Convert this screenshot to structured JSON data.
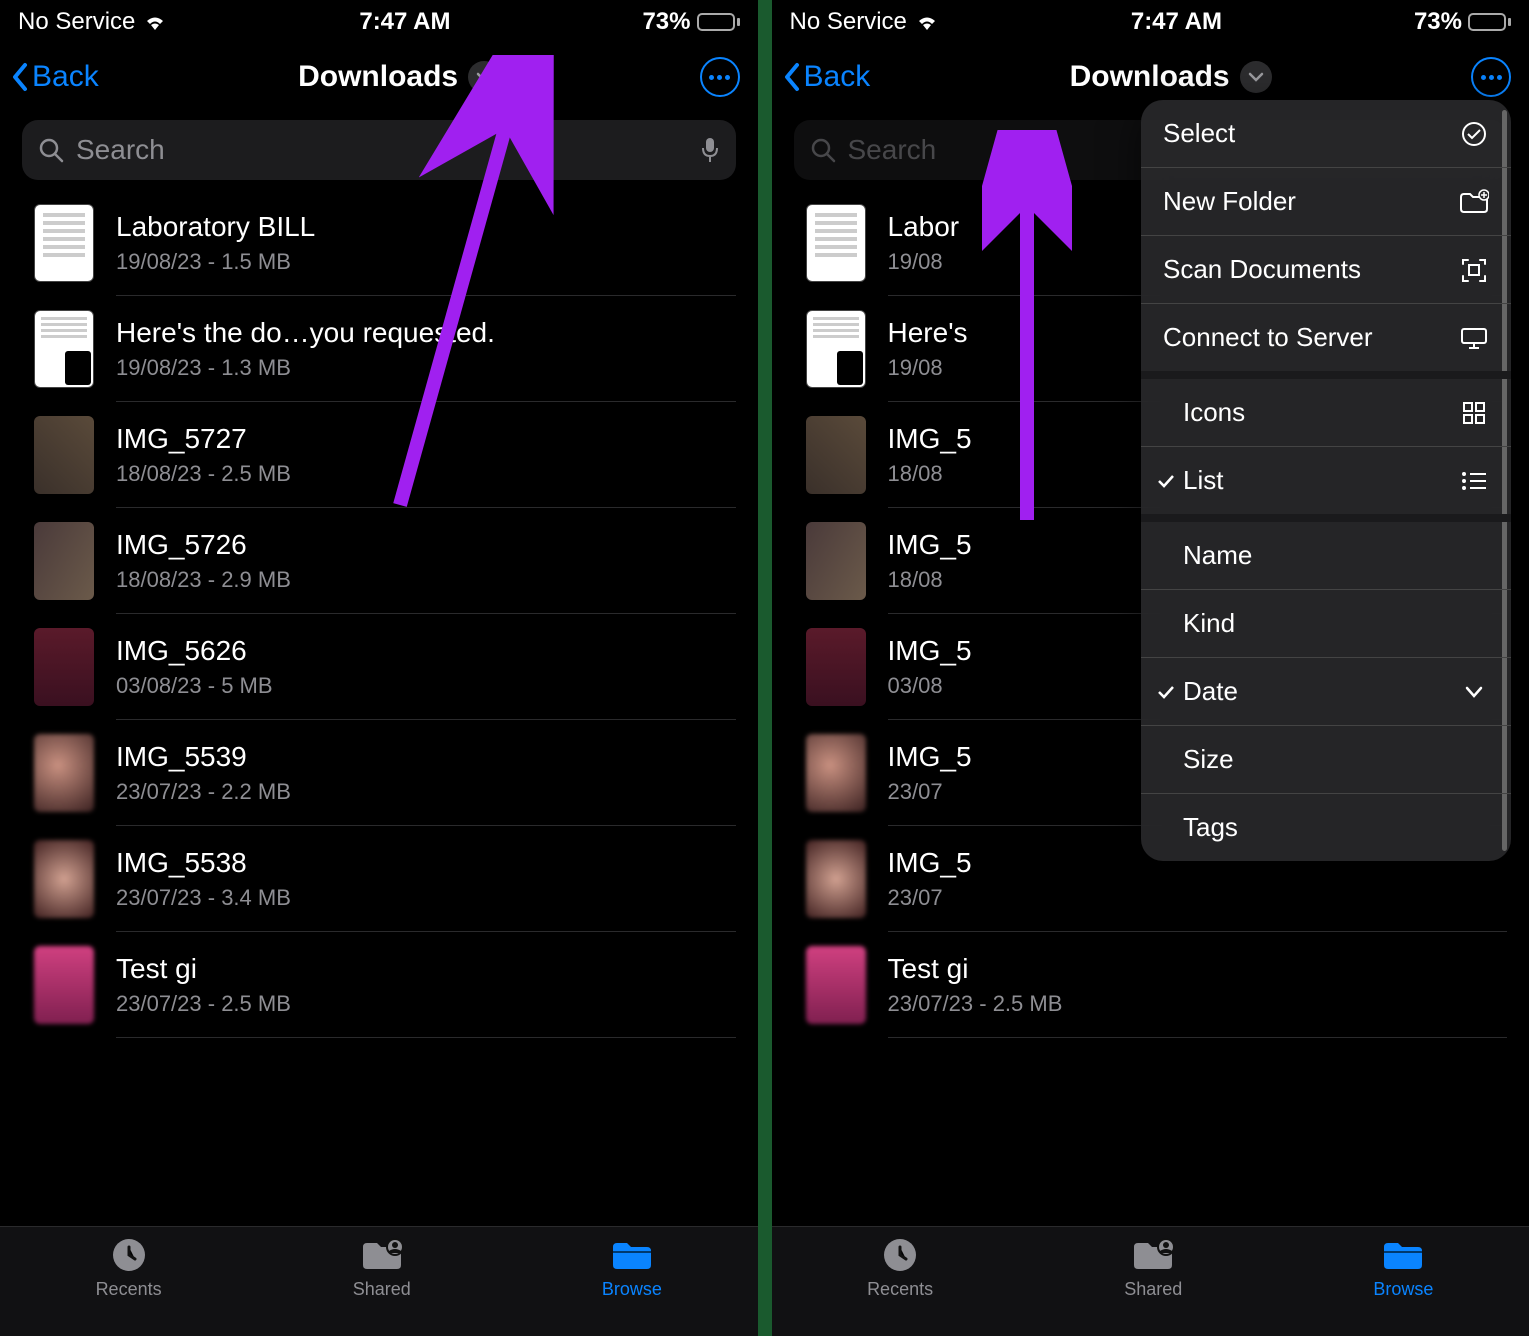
{
  "status": {
    "service": "No Service",
    "time": "7:47 AM",
    "battery_pct": "73%"
  },
  "nav": {
    "back": "Back",
    "title": "Downloads"
  },
  "search": {
    "placeholder": "Search"
  },
  "files": [
    {
      "title": "Laboratory BILL",
      "sub": "19/08/23 - 1.5 MB",
      "thumb": "doc"
    },
    {
      "title": "Here's the do…you requested.",
      "sub": "19/08/23 - 1.3 MB",
      "thumb": "doc2"
    },
    {
      "title": "IMG_5727",
      "sub": "18/08/23 - 2.5 MB",
      "thumb": "photo1"
    },
    {
      "title": "IMG_5726",
      "sub": "18/08/23 - 2.9 MB",
      "thumb": "photo2"
    },
    {
      "title": "IMG_5626",
      "sub": "03/08/23 - 5 MB",
      "thumb": "photo3"
    },
    {
      "title": "IMG_5539",
      "sub": "23/07/23 - 2.2 MB",
      "thumb": "blur1"
    },
    {
      "title": "IMG_5538",
      "sub": "23/07/23 - 3.4 MB",
      "thumb": "blur2"
    },
    {
      "title": "Test gi",
      "sub": "23/07/23 - 2.5 MB",
      "thumb": "blur3"
    }
  ],
  "files_truncated": [
    {
      "title": "Labor",
      "sub": "19/08"
    },
    {
      "title": "Here's",
      "sub": "19/08"
    },
    {
      "title": "IMG_5",
      "sub": "18/08"
    },
    {
      "title": "IMG_5",
      "sub": "18/08"
    },
    {
      "title": "IMG_5",
      "sub": "03/08"
    },
    {
      "title": "IMG_5",
      "sub": "23/07"
    },
    {
      "title": "IMG_5",
      "sub": "23/07"
    },
    {
      "title": "Test gi",
      "sub": "23/07/23 - 2.5 MB"
    }
  ],
  "tabs": {
    "recents": "Recents",
    "shared": "Shared",
    "browse": "Browse"
  },
  "menu": {
    "select": "Select",
    "new_folder": "New Folder",
    "scan": "Scan Documents",
    "connect": "Connect to Server",
    "icons": "Icons",
    "list": "List",
    "name": "Name",
    "kind": "Kind",
    "date": "Date",
    "size": "Size",
    "tags": "Tags"
  }
}
